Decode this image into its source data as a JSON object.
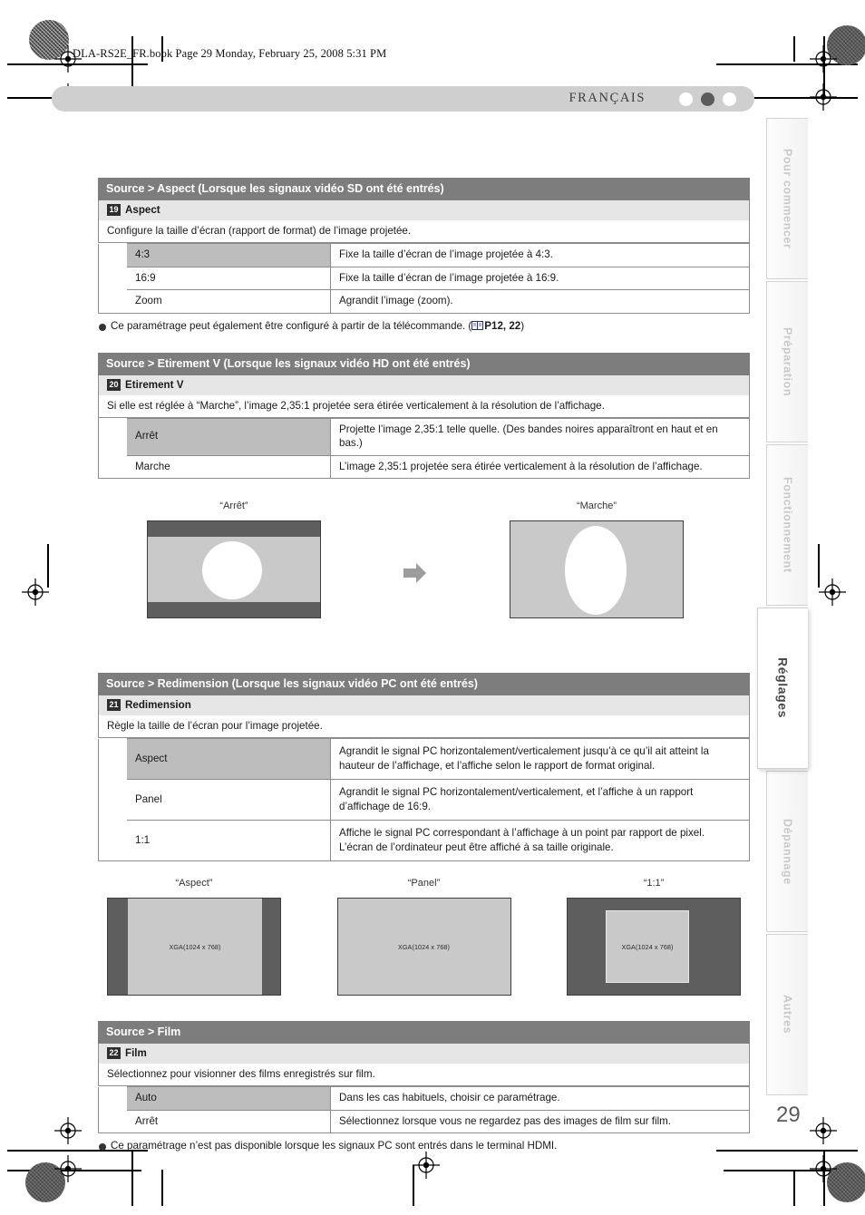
{
  "file_header": "DLA-RS2E_FR.book  Page 29  Monday, February 25, 2008  5:31 PM",
  "language_bar": {
    "language": "FRANÇAIS"
  },
  "page_number": "29",
  "sections": [
    {
      "title": "Source > Aspect (Lorsque les signaux vidéo SD ont été entrés)",
      "badge": "19",
      "sub_label": "Aspect",
      "description": "Configure la taille d’écran (rapport de format) de l’image projetée.",
      "options": [
        {
          "key": "4:3",
          "value": "Fixe la taille d’écran de l’image projetée à 4:3.",
          "highlight": true
        },
        {
          "key": "16:9",
          "value": "Fixe la taille d’écran de l’image projetée à 16:9.",
          "highlight": false
        },
        {
          "key": "Zoom",
          "value": "Agrandit l’image (zoom).",
          "highlight": false
        }
      ],
      "note": {
        "text_before": "Ce paramétrage peut également être configuré à partir de la télécommande. (",
        "icon": "book-icon",
        "reference": "P12",
        "reference_extra": ", 22",
        "text_after": ")"
      }
    },
    {
      "title": "Source > Etirement V (Lorsque les signaux vidéo HD ont été entrés)",
      "badge": "20",
      "sub_label": "Etirement V",
      "description": "Si elle est réglée à “Marche”, l’image 2,35:1 projetée sera étirée verticalement à la résolution de l’affichage.",
      "options": [
        {
          "key": "Arrêt",
          "value": "Projette l’image 2,35:1 telle quelle. (Des bandes noires apparaîtront en haut et en bas.)",
          "highlight": true
        },
        {
          "key": "Marche",
          "value": "L’image 2,35:1 projetée sera étirée verticalement à la résolution de l’affichage.",
          "highlight": false
        }
      ]
    },
    {
      "title": "Source > Redimension (Lorsque les signaux vidéo PC ont été entrés)",
      "badge": "21",
      "sub_label": "Redimension",
      "description": "Règle la taille de l’écran pour l’image projetée.",
      "options": [
        {
          "key": "Aspect",
          "value": "Agrandit le signal PC horizontalement/verticalement jusqu’à ce qu’il ait atteint la hauteur de l’affichage, et l’affiche selon le rapport de format original.",
          "highlight": true
        },
        {
          "key": "Panel",
          "value": "Agrandit le signal PC horizontalement/verticalement, et l’affiche à un rapport d’affichage de 16:9.",
          "highlight": false
        },
        {
          "key": "1:1",
          "value": "Affiche le signal PC correspondant à l’affichage à un point par rapport de pixel. L’écran de l’ordinateur peut être affiché à sa taille originale.",
          "highlight": false
        }
      ]
    },
    {
      "title": "Source > Film",
      "badge": "22",
      "sub_label": "Film",
      "description": "Sélectionnez pour visionner des films enregistrés sur film.",
      "options": [
        {
          "key": "Auto",
          "value": "Dans les cas habituels, choisir ce paramétrage.",
          "highlight": true
        },
        {
          "key": "Arrêt",
          "value": "Sélectionnez lorsque vous ne regardez pas des images de film sur film.",
          "highlight": false
        }
      ],
      "note": {
        "text_before": "Ce paramétrage n’est pas disponible lorsque les signaux PC sont entrés dans le terminal HDMI.",
        "icon": "",
        "reference": "",
        "reference_extra": "",
        "text_after": ""
      }
    }
  ],
  "figures_stretch": {
    "left_caption": "“Arrêt”",
    "right_caption": "“Marche”",
    "arrow_icon": "right-arrow-icon"
  },
  "figures_resize": [
    {
      "caption": "“Aspect”",
      "label": "XGA(1024 x 768)"
    },
    {
      "caption": "“Panel”",
      "label": "XGA(1024 x 768)"
    },
    {
      "caption": "“1:1”",
      "label": "XGA(1024 x 768)"
    }
  ],
  "side_tabs": [
    {
      "label": "Pour commencer",
      "active": false
    },
    {
      "label": "Préparation",
      "active": false
    },
    {
      "label": "Fonctionnement",
      "active": false
    },
    {
      "label": "Réglages",
      "active": true
    },
    {
      "label": "Dépannage",
      "active": false
    },
    {
      "label": "Autres",
      "active": false
    }
  ],
  "colors": {
    "section_header": "#7d7d7d",
    "sub_header": "#e6e6e6",
    "highlight_cell": "#bdbdbd",
    "screen_gray": "#c9c9c9",
    "screen_dark": "#5e5e5e"
  }
}
